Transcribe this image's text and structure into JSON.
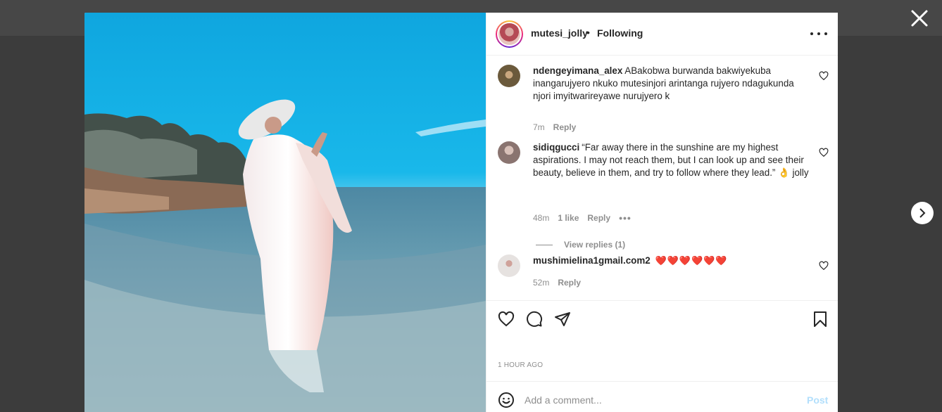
{
  "post": {
    "author": "mutesi_jolly",
    "separator": "•",
    "follow_status": "Following",
    "timestamp": "1 HOUR AGO"
  },
  "comments": [
    {
      "username": "ndengeyimana_alex",
      "text": "ABakobwa burwanda bakwiyekuba inangarujyero nkuko mutesinjori arintanga rujyero ndagukunda njori imyitwarireyawe nurujyero k",
      "time": "7m",
      "reply_label": "Reply"
    },
    {
      "username": "sidiqgucci",
      "text": "“Far away there in the sunshine are my highest aspirations. I may not reach them, but I can look up and see their beauty, believe in them, and try to follow where they lead.” 👌 jolly",
      "time": "48m",
      "likes": "1 like",
      "reply_label": "Reply",
      "more": "•••",
      "view_replies": "View replies (1)"
    },
    {
      "username": "mushimielina1gmail.com2",
      "text": "❤️❤️❤️❤️❤️❤️",
      "time": "52m",
      "reply_label": "Reply"
    }
  ],
  "add_comment": {
    "placeholder": "Add a comment...",
    "post_label": "Post",
    "post_color": "#b2dffc"
  },
  "icons": {
    "close": "close-icon",
    "next": "chevron-right-icon",
    "more": "more-horizontal-icon",
    "like": "heart-icon",
    "comment": "comment-icon",
    "share": "paper-plane-icon",
    "save": "bookmark-icon",
    "emoji": "smiley-icon"
  },
  "colors": {
    "story_ring": "#ee2a7b",
    "heart_red": "#ed1c24"
  }
}
